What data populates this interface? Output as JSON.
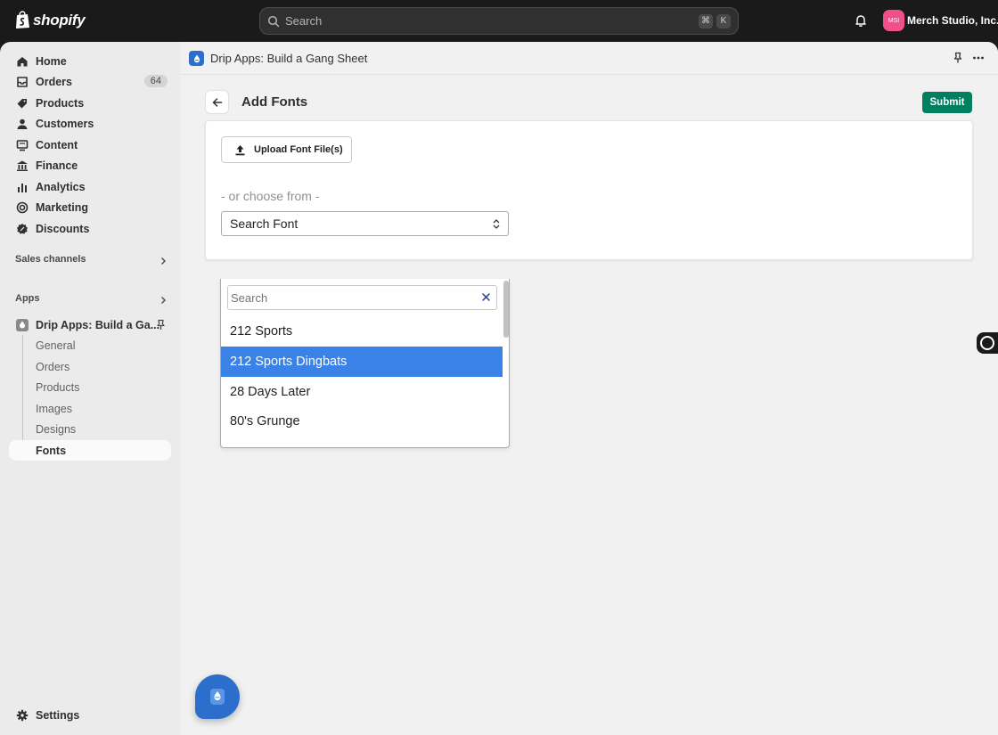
{
  "topbar": {
    "brand": "shopify",
    "search_placeholder": "Search",
    "shortcut_cmd": "⌘",
    "shortcut_key": "K",
    "avatar_initials": "MSI",
    "store_name": "Merch Studio, Inc."
  },
  "sidebar": {
    "items": [
      {
        "label": "Home",
        "icon": "home-icon"
      },
      {
        "label": "Orders",
        "icon": "orders-icon",
        "badge": "64"
      },
      {
        "label": "Products",
        "icon": "tag-icon"
      },
      {
        "label": "Customers",
        "icon": "person-icon"
      },
      {
        "label": "Content",
        "icon": "content-icon"
      },
      {
        "label": "Finance",
        "icon": "bank-icon"
      },
      {
        "label": "Analytics",
        "icon": "analytics-icon"
      },
      {
        "label": "Marketing",
        "icon": "target-icon"
      },
      {
        "label": "Discounts",
        "icon": "discount-icon"
      }
    ],
    "sales_channels_label": "Sales channels",
    "apps_label": "Apps",
    "app_name": "Drip Apps: Build a Ga...",
    "app_subitems": [
      "General",
      "Orders",
      "Products",
      "Images",
      "Designs",
      "Fonts"
    ],
    "active_subitem": "Fonts",
    "settings_label": "Settings"
  },
  "appbar": {
    "title": "Drip Apps: Build a Gang Sheet"
  },
  "page": {
    "title": "Add Fonts",
    "submit_label": "Submit",
    "upload_label": "Upload Font File(s)",
    "or_text": "- or choose from -",
    "select_value": "Search Font"
  },
  "dropdown": {
    "search_placeholder": "Search",
    "options": [
      "212 Sports",
      "212 Sports Dingbats",
      "28 Days Later",
      "80's Grunge"
    ],
    "highlighted": "212 Sports Dingbats"
  },
  "colors": {
    "submit": "#008060",
    "highlight": "#3b82e8",
    "app_blue": "#2c6ecb",
    "avatar": "#f0508a"
  }
}
